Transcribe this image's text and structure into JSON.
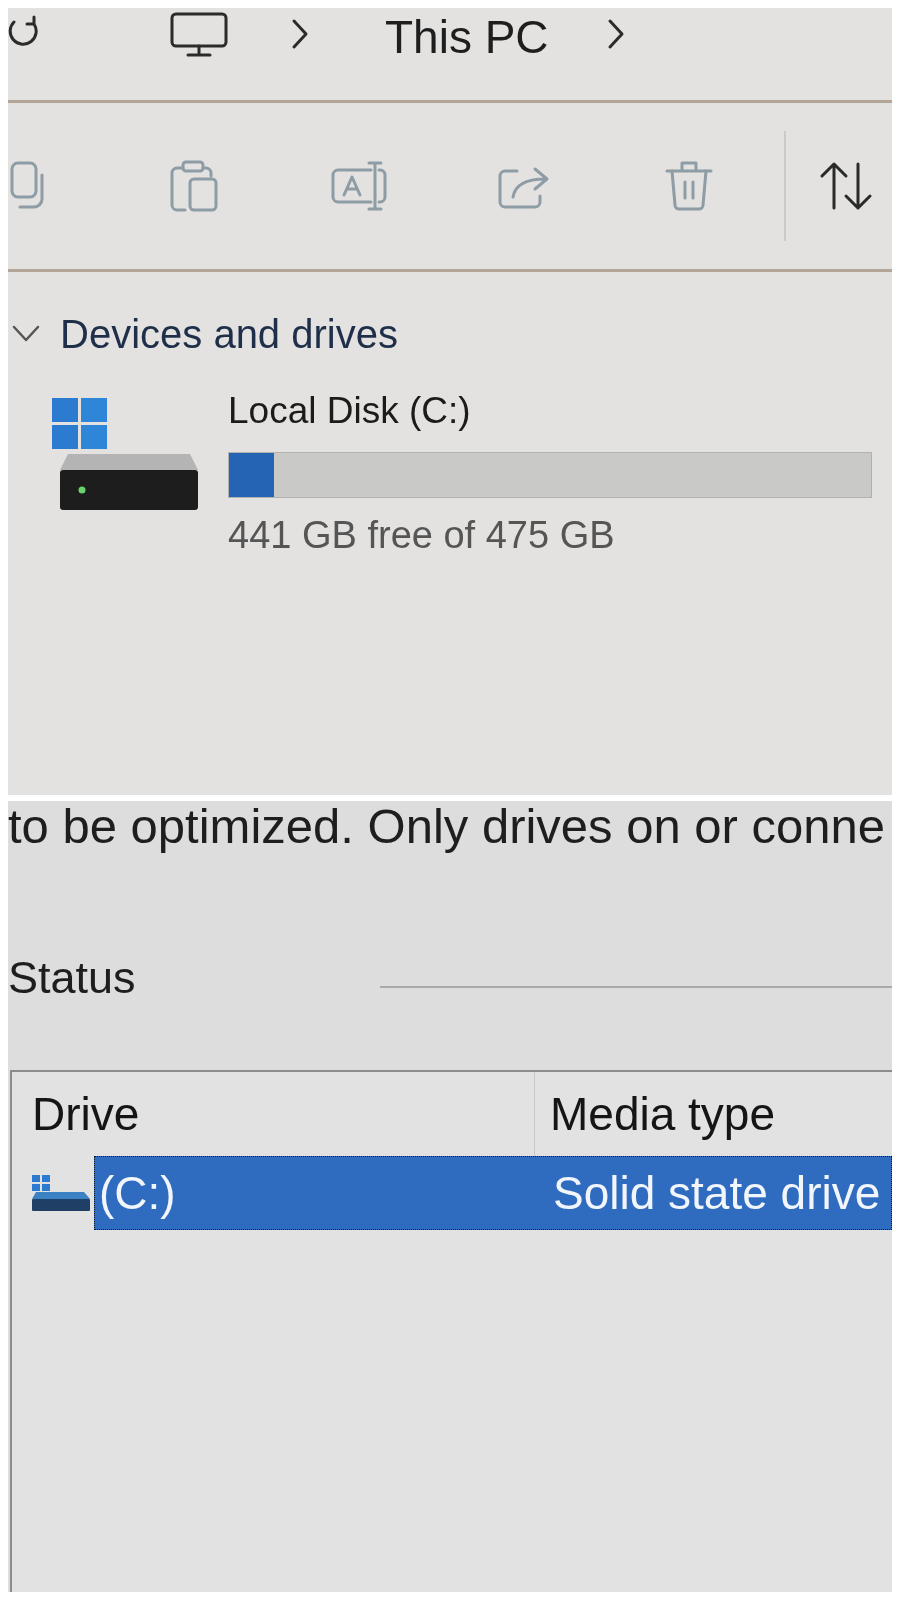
{
  "breadcrumb": {
    "location": "This PC"
  },
  "toolbar": {
    "buttons": [
      {
        "kind": "copy",
        "disabled": true
      },
      {
        "kind": "paste",
        "disabled": true
      },
      {
        "kind": "rename",
        "disabled": true
      },
      {
        "kind": "share",
        "disabled": true
      },
      {
        "kind": "delete",
        "disabled": true
      },
      {
        "kind": "sort",
        "disabled": false
      }
    ]
  },
  "devices_section": {
    "title": "Devices and drives",
    "expanded": true,
    "drives": [
      {
        "name": "Local Disk (C:)",
        "level": 0.07,
        "space": "441 GB free of 475 GB"
      }
    ]
  },
  "optimize_panel": {
    "description": "to be optimized. Only drives on or conne",
    "status_label": "Status",
    "table": {
      "columns": [
        "Drive",
        "Media type"
      ],
      "rows": [
        {
          "drive": "(C:)",
          "media_type": "Solid state drive",
          "selected": true
        }
      ]
    }
  }
}
